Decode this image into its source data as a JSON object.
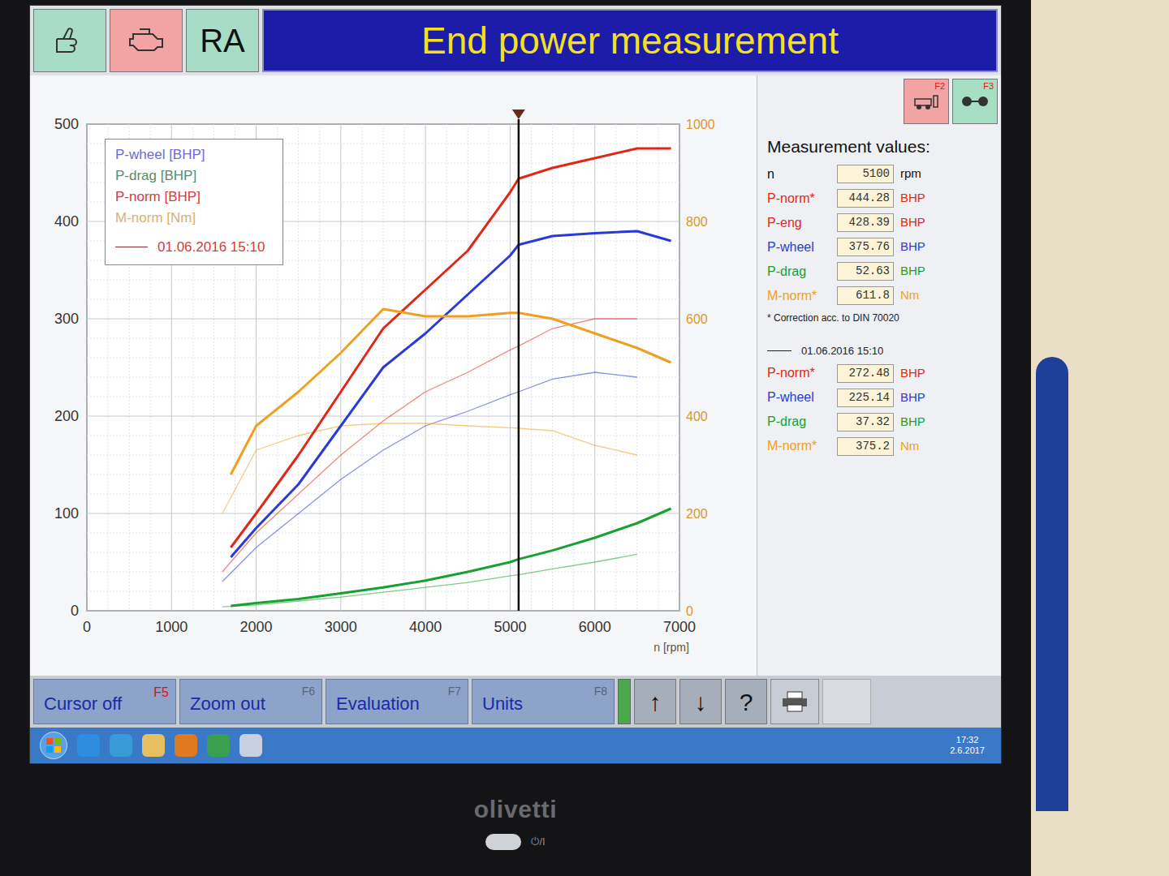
{
  "toolbar": {
    "mode": "RA"
  },
  "title": "End power measurement",
  "side_keys": [
    {
      "key": "F2",
      "color": "#f2a3a3"
    },
    {
      "key": "F3",
      "color": "#a6dfc4"
    }
  ],
  "chart": {
    "y_left_ticks": [
      "0",
      "100",
      "200",
      "300",
      "400",
      "500"
    ],
    "y_right_ticks": [
      "0",
      "200",
      "400",
      "600",
      "800",
      "1000"
    ],
    "x_ticks": [
      "0",
      "1000",
      "2000",
      "3000",
      "4000",
      "5000",
      "6000",
      "7000"
    ],
    "x_label": "n [rpm]",
    "cursor_rpm": 5100,
    "legend": [
      {
        "label": "P-wheel [BHP]",
        "color": "#6a6ad8"
      },
      {
        "label": "P-drag [BHP]",
        "color": "#5b8a6a"
      },
      {
        "label": "P-norm [BHP]",
        "color": "#d04040"
      },
      {
        "label": "M-norm [Nm]",
        "color": "#d8b070"
      }
    ],
    "reference_label": "01.06.2016 15:10",
    "rpm": [
      1700,
      2000,
      2500,
      3000,
      3500,
      4000,
      4500,
      5000,
      5100,
      5500,
      6000,
      6500,
      6900
    ],
    "reference_rpm": [
      1600,
      2000,
      2500,
      3000,
      3500,
      4000,
      4500,
      5000,
      5100,
      5500,
      6000,
      6500
    ],
    "series": [
      {
        "name": "P-wheel",
        "axis": "left",
        "color": "#2a3ad8",
        "values": [
          55,
          85,
          130,
          190,
          250,
          285,
          325,
          365,
          376,
          385,
          388,
          390,
          380
        ],
        "reference_values": [
          30,
          65,
          100,
          135,
          165,
          190,
          205,
          222,
          225,
          238,
          245,
          240
        ]
      },
      {
        "name": "P-drag",
        "axis": "left",
        "color": "#18a030",
        "values": [
          5,
          8,
          12,
          18,
          24,
          31,
          40,
          50,
          53,
          62,
          75,
          90,
          105
        ],
        "reference_values": [
          4,
          6,
          10,
          14,
          19,
          24,
          29,
          36,
          37,
          43,
          50,
          58
        ]
      },
      {
        "name": "P-norm",
        "axis": "left",
        "color": "#e02818",
        "values": [
          65,
          100,
          160,
          225,
          290,
          330,
          370,
          430,
          444,
          455,
          465,
          475,
          475
        ],
        "reference_values": [
          40,
          80,
          120,
          160,
          195,
          225,
          245,
          268,
          272,
          290,
          300,
          300
        ]
      },
      {
        "name": "M-norm",
        "axis": "right",
        "color": "#f0a020",
        "values": [
          280,
          380,
          450,
          530,
          620,
          605,
          605,
          612,
          612,
          600,
          570,
          540,
          510
        ],
        "reference_values": [
          200,
          330,
          360,
          380,
          385,
          385,
          380,
          376,
          375,
          370,
          340,
          320
        ]
      }
    ]
  },
  "values_panel": {
    "title": "Measurement values:",
    "rows": [
      {
        "label": "n",
        "value": "5100",
        "unit": "rpm",
        "color": "#111111"
      },
      {
        "label": "P-norm*",
        "value": "444.28",
        "unit": "BHP",
        "color": "#e02818"
      },
      {
        "label": "P-eng",
        "value": "428.39",
        "unit": "BHP",
        "color": "#e02818"
      },
      {
        "label": "P-wheel",
        "value": "375.76",
        "unit": "BHP",
        "color": "#2a3ad8"
      },
      {
        "label": "P-drag",
        "value": "52.63",
        "unit": "BHP",
        "color": "#18a030"
      },
      {
        "label": "M-norm*",
        "value": "611.8",
        "unit": "Nm",
        "color": "#f0a020"
      }
    ],
    "note": "* Correction acc. to DIN 70020",
    "reference_label": "01.06.2016 15:10",
    "reference_rows": [
      {
        "label": "P-norm*",
        "value": "272.48",
        "unit": "BHP",
        "color": "#e02818"
      },
      {
        "label": "P-wheel",
        "value": "225.14",
        "unit": "BHP",
        "color": "#2a3ad8"
      },
      {
        "label": "P-drag",
        "value": "37.32",
        "unit": "BHP",
        "color": "#18a030"
      },
      {
        "label": "M-norm*",
        "value": "375.2",
        "unit": "Nm",
        "color": "#f0a020"
      }
    ]
  },
  "function_keys": [
    {
      "label": "Cursor off",
      "key": "F5",
      "active": true
    },
    {
      "label": "Zoom out",
      "key": "F6",
      "active": false
    },
    {
      "label": "Evaluation",
      "key": "F7",
      "active": false
    },
    {
      "label": "Units",
      "key": "F8",
      "active": false
    }
  ],
  "icon_keys": [
    "↑",
    "↓",
    "?"
  ],
  "taskbar": {
    "time": "17:32",
    "date": "2.6.2017"
  },
  "monitor": {
    "brand": "olivetti",
    "power_label": "⏻/I"
  }
}
